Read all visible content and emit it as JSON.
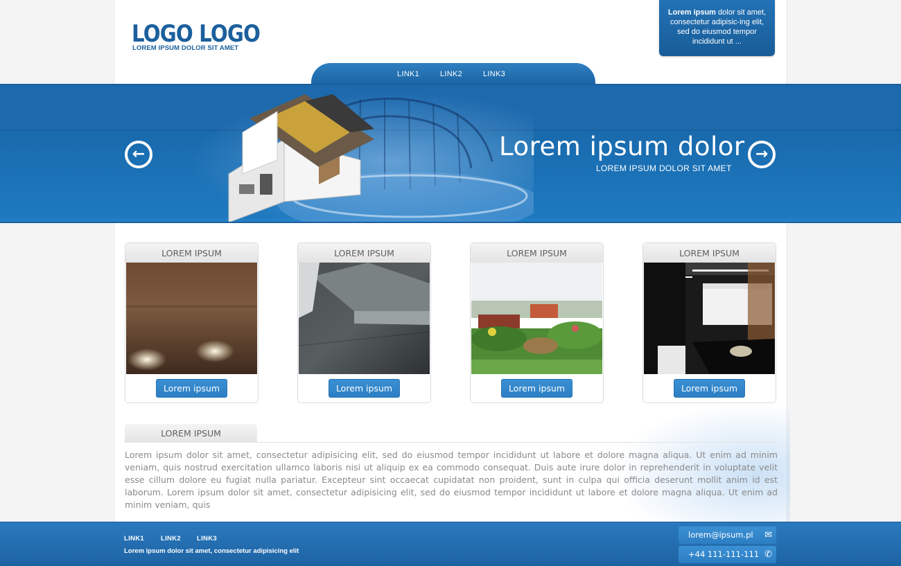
{
  "header": {
    "logo": "LOGO LOGO",
    "tagline": "LOREM IPSUM DOLOR SIT AMET",
    "info": {
      "bold": "Lorem ipsum",
      "text": " dolor sit amet, consectetur adipisic-ing elit, sed do eiusmod tempor incididunt ut ..."
    }
  },
  "nav": {
    "links": [
      "LINK1",
      "LINK2",
      "LINK3"
    ]
  },
  "banner": {
    "title": "Lorem ipsum dolor",
    "subtitle": "LOREM IPSUM DOLOR SIT AMET",
    "prev_icon": "arrow-left-circle-icon",
    "next_icon": "arrow-right-circle-icon"
  },
  "cards": [
    {
      "title": "LOREM IPSUM",
      "button": "Lorem ipsum",
      "image": "wood-wall-lights"
    },
    {
      "title": "LOREM IPSUM",
      "button": "Lorem ipsum",
      "image": "concrete-stairs-floor"
    },
    {
      "title": "LOREM IPSUM",
      "button": "Lorem ipsum",
      "image": "garden-landscape"
    },
    {
      "title": "LOREM IPSUM",
      "button": "Lorem ipsum",
      "image": "black-kitchen-interior"
    }
  ],
  "section": {
    "title": "LOREM IPSUM",
    "body": "Lorem ipsum dolor sit amet, consectetur adipisicing elit, sed do eiusmod tempor incididunt ut labore et dolore magna aliqua. Ut enim ad minim veniam, quis nostrud exercitation ullamco laboris nisi ut aliquip ex ea commodo consequat. Duis aute irure dolor in reprehenderit in voluptate velit esse cillum dolore eu fugiat nulla pariatur. Excepteur sint occaecat cupidatat non proident, sunt in culpa qui officia deserunt mollit anim id est laborum. Lorem ipsum dolor sit amet, consectetur adipisicing elit, sed do eiusmod tempor incididunt ut labore et dolore magna aliqua. Ut enim ad minim veniam, quis"
  },
  "footer": {
    "links": [
      "LINK1",
      "LINK2",
      "LINK3"
    ],
    "text": "Lorem ipsum dolor sit amet, consectetur adipisicing elit",
    "email": "lorem@ipsum.pl",
    "phone": "+44 111-111-111",
    "email_icon": "envelope-icon",
    "phone_icon": "phone-icon"
  },
  "colors": {
    "brand_blue": "#1c69ad",
    "button_blue": "#3a8fd3",
    "logo_blue": "#1b5f9c",
    "body_text": "#8a8a8a"
  }
}
